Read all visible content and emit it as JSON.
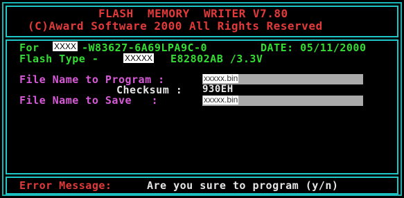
{
  "title": {
    "line1": "FLASH  MEMORY  WRITER V7.80",
    "line2": "(C)Award Software 2000 All Rights Reserved"
  },
  "info": {
    "for_label": "For",
    "for_mask": "XXXX",
    "for_value": "-W83627-6A69LPA9C-0",
    "date_text": "DATE: 05/11/2000",
    "flash_type_label": "Flash Type -",
    "flash_type_mask": "XXXXX",
    "flash_type_value": "E82802AB /3.3V"
  },
  "fields": {
    "program_label": "File Name to Program :",
    "program_value": "xxxxx.bin",
    "checksum_label": "Checksum :",
    "checksum_value": "930EH",
    "save_label": "File Name to Save   :",
    "save_value": "xxxxx.bin"
  },
  "status": {
    "error_label": "Error Message:",
    "message": "Are you sure to program (y/n)"
  },
  "colors": {
    "border": "#1ec8c8",
    "title": "#e23a3a",
    "info": "#33dd33",
    "labels": "#d85ad8",
    "message": "#e6e6e6",
    "field_bar": "#aaaaaa"
  }
}
